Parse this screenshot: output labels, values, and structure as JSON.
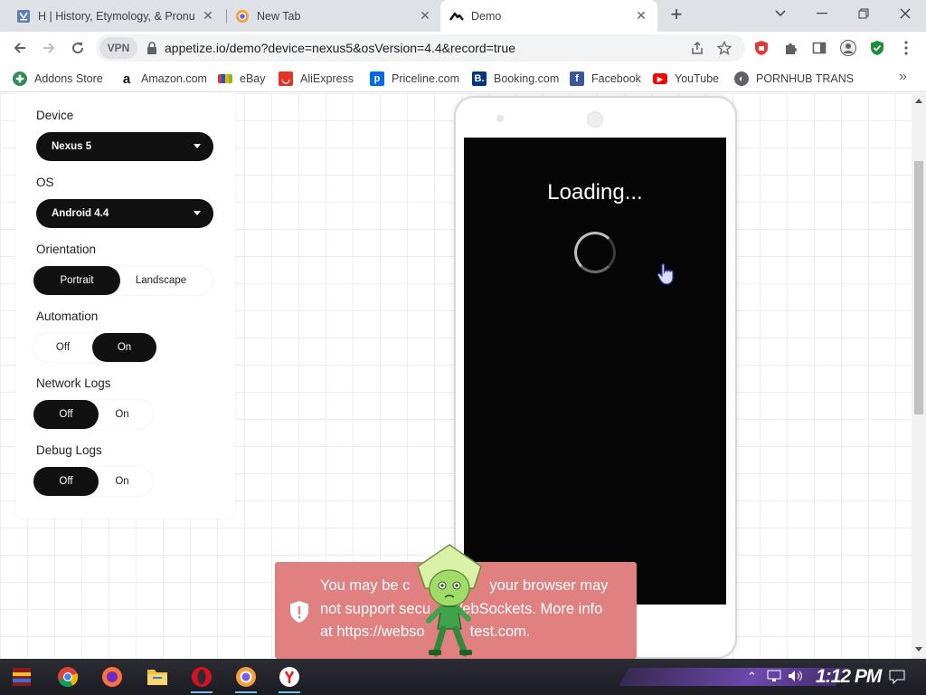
{
  "browser": {
    "tabs": [
      {
        "title": "H | History, Etymology, & Pronu",
        "favicon": "britannica-icon",
        "active": false
      },
      {
        "title": "New Tab",
        "favicon": "chrome-newtab-icon",
        "active": false
      },
      {
        "title": "Demo",
        "favicon": "appetize-icon",
        "active": true
      }
    ],
    "window_controls": [
      "tab-search",
      "minimize",
      "restore",
      "close"
    ]
  },
  "toolbar": {
    "vpn_label": "VPN",
    "url": "appetize.io/demo?device=nexus5&osVersion=4.4&record=true"
  },
  "bookmarks": [
    {
      "label": "Addons Store",
      "icon": "addons-store-icon",
      "color": "#2e8b57"
    },
    {
      "label": "Amazon.com",
      "icon": "amazon-icon",
      "color": "#111111"
    },
    {
      "label": "eBay",
      "icon": "ebay-icon",
      "color": "#444444"
    },
    {
      "label": "AliExpress",
      "icon": "aliexpress-icon",
      "color": "#e43225"
    },
    {
      "label": "Priceline.com",
      "icon": "priceline-icon",
      "color": "#0068ef"
    },
    {
      "label": "Booking.com",
      "icon": "booking-icon",
      "color": "#003580"
    },
    {
      "label": "Facebook",
      "icon": "facebook-icon",
      "color": "#3b5998"
    },
    {
      "label": "YouTube",
      "icon": "youtube-icon",
      "color": "#ff0000"
    },
    {
      "label": "PORNHUB TRANS",
      "icon": "globe-icon",
      "color": "#5f6368"
    }
  ],
  "settings": {
    "device_label": "Device",
    "device_value": "Nexus 5",
    "os_label": "OS",
    "os_value": "Android 4.4",
    "orientation_label": "Orientation",
    "orientation_options": [
      "Portrait",
      "Landscape"
    ],
    "orientation_selected": "Portrait",
    "automation_label": "Automation",
    "automation_options": [
      "Off",
      "On"
    ],
    "automation_selected": "On",
    "network_logs_label": "Network Logs",
    "network_logs_options": [
      "Off",
      "On"
    ],
    "network_logs_selected": "Off",
    "debug_logs_label": "Debug Logs",
    "debug_logs_options": [
      "Off",
      "On"
    ],
    "debug_logs_selected": "Off"
  },
  "phone": {
    "loading_text": "Loading..."
  },
  "warning": {
    "text": "You may be c... your browser may not support secu... WebSockets. More info at https://websoc...test.com.",
    "line1": "You may be c",
    "line1_tail": "your browser may",
    "line2": "not support secu",
    "line2_tail": "WebSockets. More info",
    "line3": "at https://webso",
    "line3_tail": "test.com.",
    "color": "#e08080"
  },
  "taskbar": {
    "clock": "1:12 PM",
    "apps": [
      "winrar-icon",
      "chrome-icon",
      "firefox-icon",
      "file-explorer-icon",
      "opera-icon",
      "brave-icon",
      "yandex-icon"
    ]
  }
}
